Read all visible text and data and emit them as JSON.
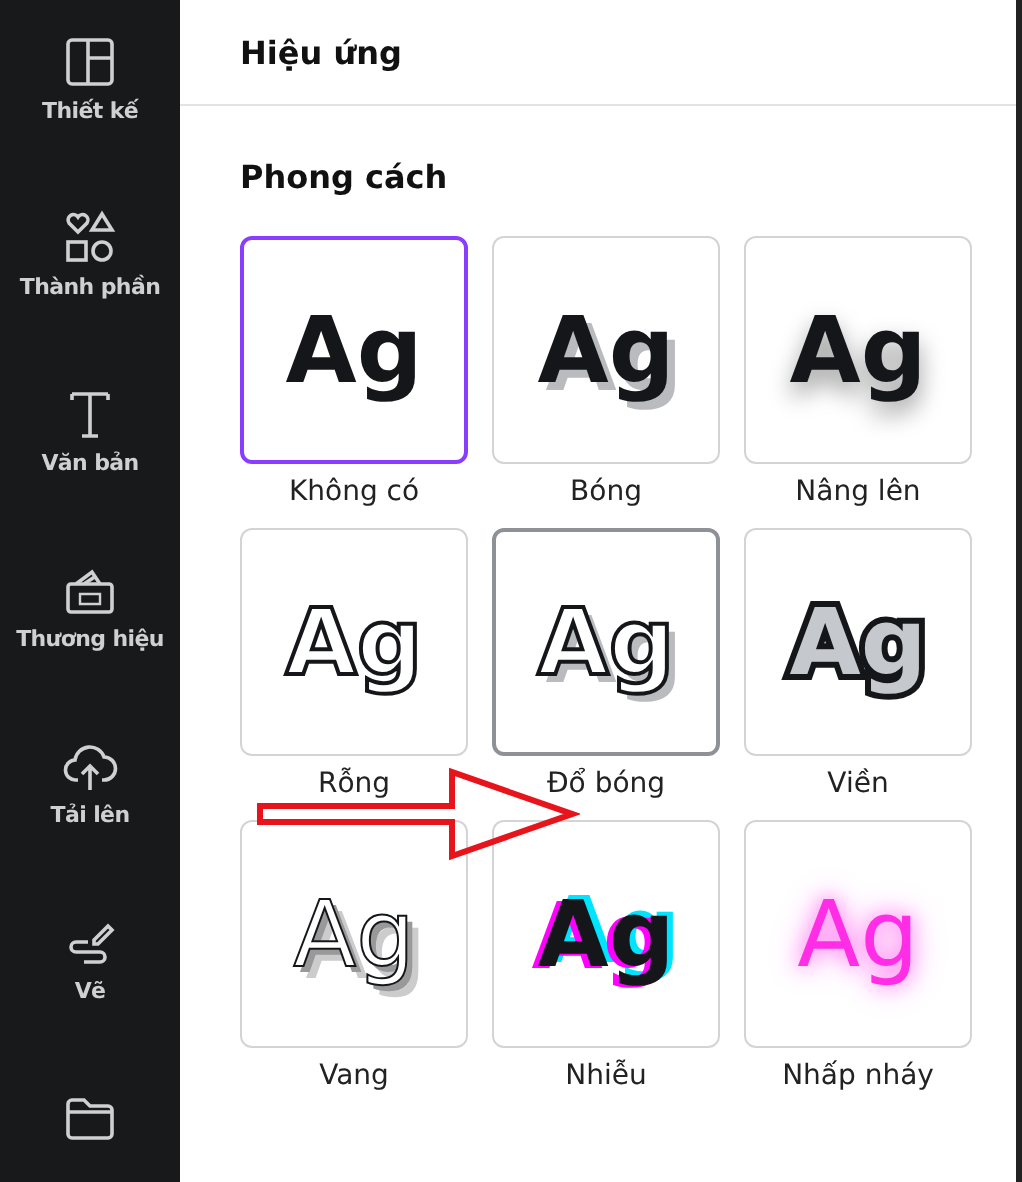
{
  "sidebar": {
    "items": [
      {
        "kind": "layout",
        "label": "Thiết kế"
      },
      {
        "kind": "shapes",
        "label": "Thành phần"
      },
      {
        "kind": "text",
        "label": "Văn bản"
      },
      {
        "kind": "brand",
        "label": "Thương hiệu"
      },
      {
        "kind": "upload",
        "label": "Tải lên"
      },
      {
        "kind": "draw",
        "label": "Vẽ"
      },
      {
        "kind": "folder"
      }
    ]
  },
  "panel": {
    "title": "Hiệu ứng",
    "section": "Phong cách",
    "styles": [
      {
        "kind": "none",
        "sample": "Ag",
        "label": "Không có",
        "selected": true,
        "hovered": false
      },
      {
        "kind": "shadow",
        "sample": "Ag",
        "label": "Bóng",
        "selected": false,
        "hovered": false
      },
      {
        "kind": "lift",
        "sample": "Ag",
        "label": "Nâng lên",
        "selected": false,
        "hovered": false
      },
      {
        "kind": "hollow",
        "sample": "Ag",
        "label": "Rỗng",
        "selected": false,
        "hovered": false
      },
      {
        "kind": "splice",
        "sample": "Ag",
        "label": "Đổ bóng",
        "selected": false,
        "hovered": true
      },
      {
        "kind": "outline",
        "sample": "Ag",
        "label": "Viền",
        "selected": false,
        "hovered": false
      },
      {
        "kind": "echo",
        "sample": "Ag",
        "label": "Vang",
        "selected": false,
        "hovered": false
      },
      {
        "kind": "glitch",
        "sample": "Ag",
        "label": "Nhiễu",
        "selected": false,
        "hovered": false
      },
      {
        "kind": "neon",
        "sample": "Ag",
        "label": "Nhấp nháy",
        "selected": false,
        "hovered": false
      }
    ]
  }
}
